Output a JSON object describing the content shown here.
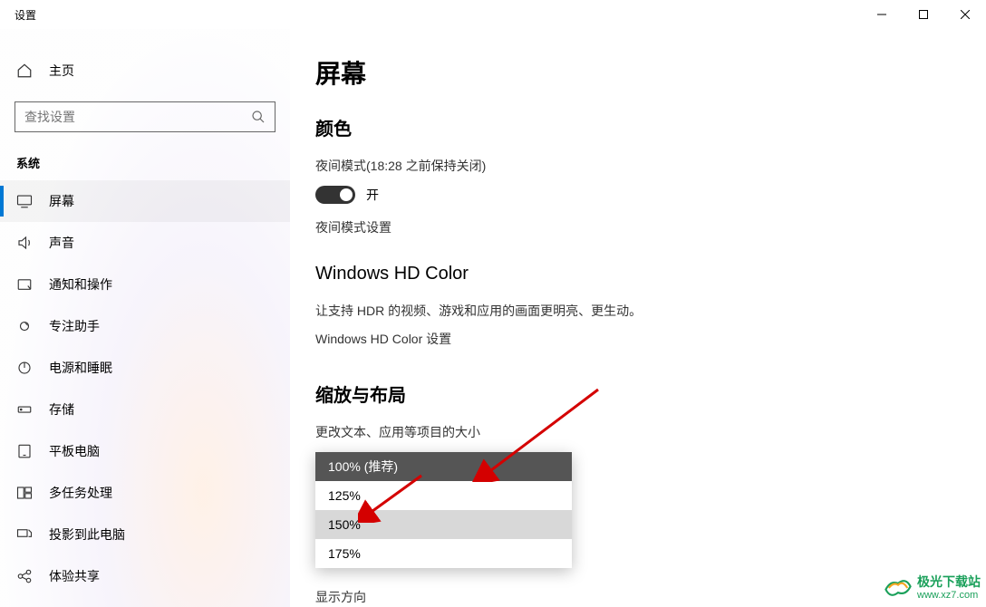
{
  "window": {
    "title": "设置"
  },
  "sidebar": {
    "home": "主页",
    "search_placeholder": "查找设置",
    "section": "系统",
    "items": [
      {
        "label": "屏幕"
      },
      {
        "label": "声音"
      },
      {
        "label": "通知和操作"
      },
      {
        "label": "专注助手"
      },
      {
        "label": "电源和睡眠"
      },
      {
        "label": "存储"
      },
      {
        "label": "平板电脑"
      },
      {
        "label": "多任务处理"
      },
      {
        "label": "投影到此电脑"
      },
      {
        "label": "体验共享"
      }
    ]
  },
  "content": {
    "title": "屏幕",
    "color": {
      "heading": "颜色",
      "night_label": "夜间模式(18:28 之前保持关闭)",
      "toggle_state": "开",
      "night_settings": "夜间模式设置"
    },
    "hd": {
      "heading": "Windows HD Color",
      "desc": "让支持 HDR 的视频、游戏和应用的画面更明亮、更生动。",
      "link": "Windows HD Color 设置"
    },
    "scale": {
      "heading": "缩放与布局",
      "label": "更改文本、应用等项目的大小",
      "options": [
        "100% (推荐)",
        "125%",
        "150%",
        "175%"
      ],
      "selected_index": 0,
      "hover_index": 2
    },
    "orientation_label": "显示方向"
  },
  "watermark": {
    "cn": "极光下载站",
    "en": "www.xz7.com"
  }
}
